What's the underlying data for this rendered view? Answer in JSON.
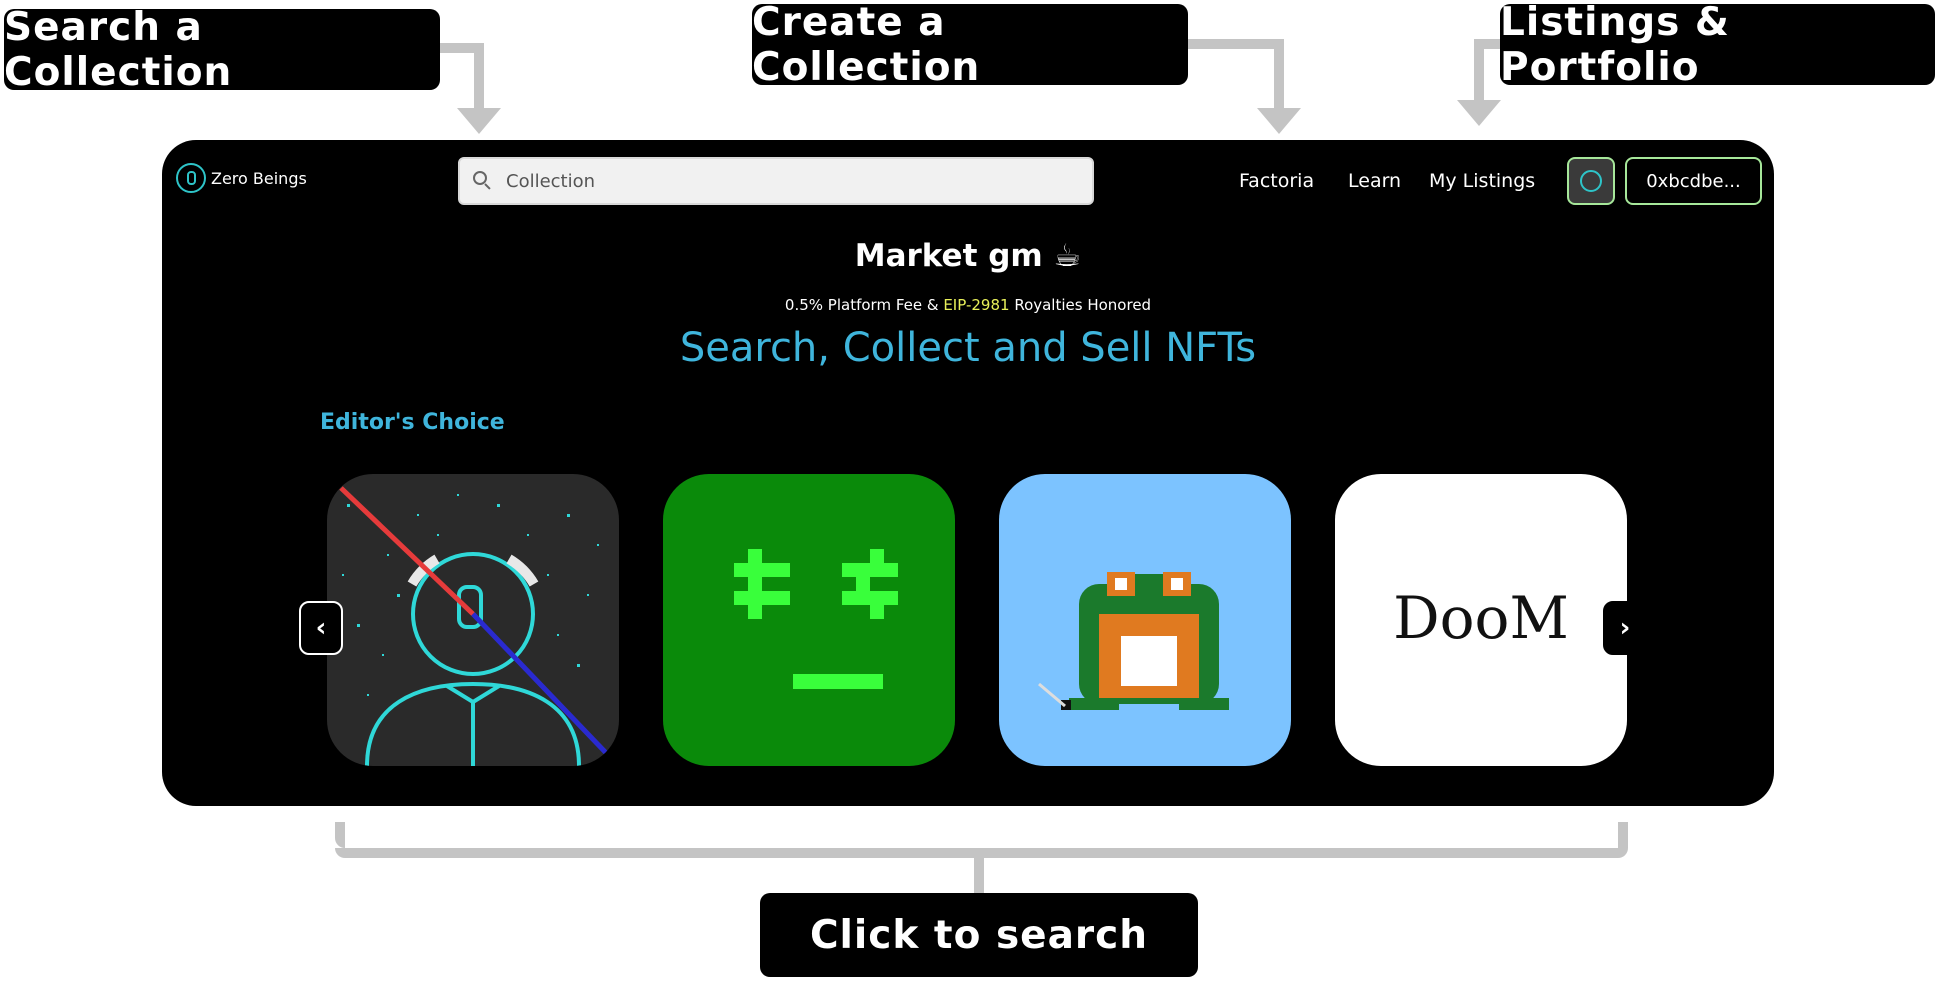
{
  "callouts": {
    "search": "Search a Collection",
    "create": "Create a Collection",
    "listings": "Listings & Portfolio",
    "click": "Click to search"
  },
  "header": {
    "brand": "Zero Beings",
    "search_placeholder": "Collection",
    "nav": [
      "Factoria",
      "Learn",
      "My Listings"
    ],
    "wallet": "0xbcdbe..."
  },
  "hero": {
    "title": "Market gm ☕",
    "sub_prefix": "0.5% Platform Fee & ",
    "sub_link": "EIP-2981",
    "sub_suffix": " Royalties Honored",
    "tagline": "Search, Collect and Sell NFTs"
  },
  "section": {
    "title": "Editor's Choice"
  },
  "carousel": {
    "prev": "‹",
    "next": "›",
    "cards": [
      {
        "name": "astronaut-nft"
      },
      {
        "name": "green-face-nft"
      },
      {
        "name": "frog-nft"
      },
      {
        "name": "doom-nft",
        "text": "DooM"
      }
    ]
  },
  "colors": {
    "accent": "#3fb5dc",
    "highlight": "#e8f05a",
    "button_border": "#a6e79a",
    "connector": "#c4c4c4"
  }
}
